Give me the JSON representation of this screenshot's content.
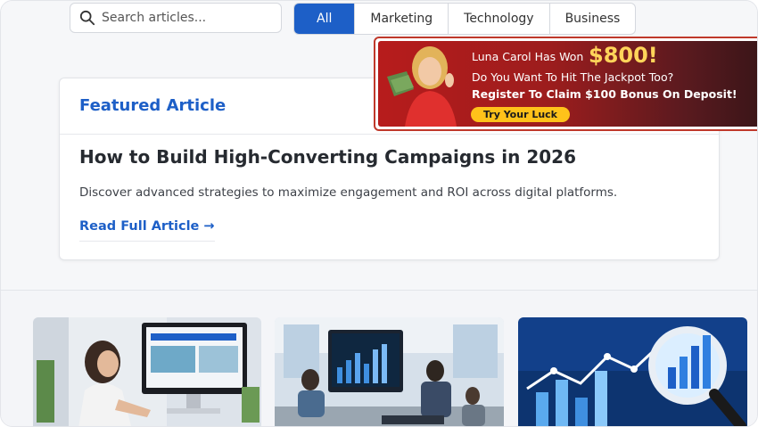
{
  "search": {
    "placeholder": "Search articles..."
  },
  "tabs": [
    {
      "label": "All",
      "active": true
    },
    {
      "label": "Marketing",
      "active": false
    },
    {
      "label": "Technology",
      "active": false
    },
    {
      "label": "Business",
      "active": false
    }
  ],
  "featured": {
    "label": "Featured Article",
    "title": "How to Build High-Converting Campaigns in 2026",
    "description": "Discover advanced strategies to maximize engagement and ROI across digital platforms.",
    "link": "Read Full Article →"
  },
  "ad": {
    "line1": "Luna Carol Has Won",
    "amount": "$800!",
    "line2": "Do You Want To Hit The Jackpot Too?",
    "line3": "Register To Claim $100 Bonus On Deposit!",
    "button": "Try Your Luck"
  },
  "thumbnails": [
    {
      "icon": "woman-at-computer-image"
    },
    {
      "icon": "office-dashboard-image"
    },
    {
      "icon": "analytics-magnifier-image"
    }
  ],
  "colors": {
    "accent": "#1d5fc7",
    "ad_red": "#b71c1c",
    "ad_gold": "#ffd45a",
    "ad_button": "#ffc21a"
  }
}
